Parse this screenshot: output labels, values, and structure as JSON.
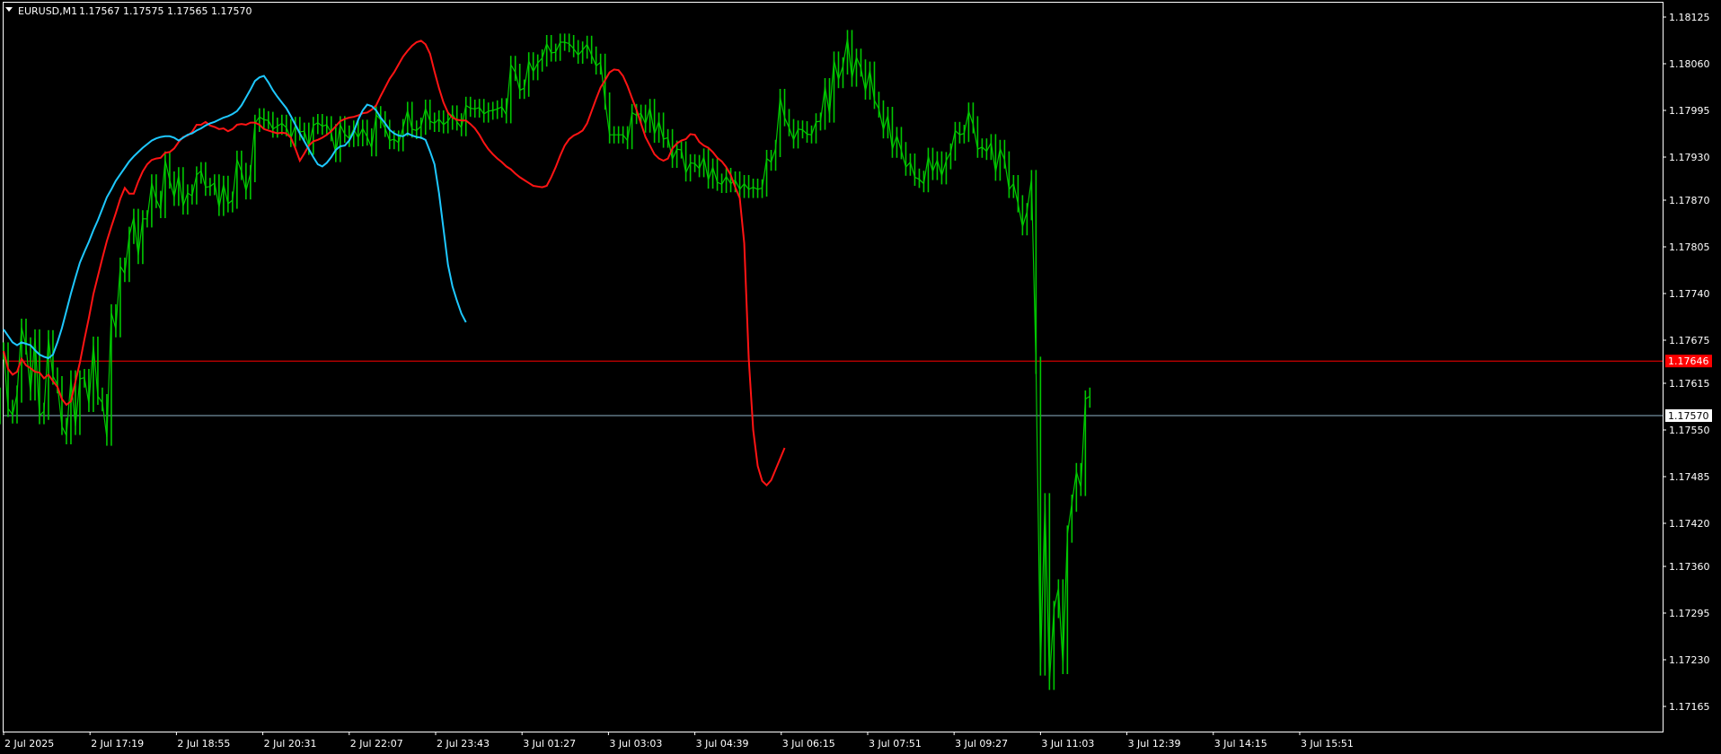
{
  "header": {
    "symbol": "EURUSD,M1",
    "ohlc": "1.17567 1.17575 1.17565 1.17570"
  },
  "colors": {
    "background": "#000000",
    "frame": "#ffffff",
    "candles": "#00c800",
    "ma_fast": "#ff1414",
    "ma_slow": "#1ec8ff",
    "bid_line": "#ff0000",
    "last_line": "#8fb4c8"
  },
  "chart_data": {
    "type": "line",
    "title": "EURUSD,M1",
    "grid": false,
    "ylim": [
      1.1713,
      1.18145
    ],
    "y_ticks": [
      "1.18125",
      "1.18060",
      "1.17995",
      "1.17930",
      "1.17870",
      "1.17805",
      "1.17740",
      "1.17675",
      "1.17615",
      "1.17550",
      "1.17485",
      "1.17420",
      "1.17360",
      "1.17295",
      "1.17230",
      "1.17165"
    ],
    "x_ticks": [
      "2 Jul 2025",
      "2 Jul 17:19",
      "2 Jul 18:55",
      "2 Jul 20:31",
      "2 Jul 22:07",
      "2 Jul 23:43",
      "3 Jul 01:27",
      "3 Jul 03:03",
      "3 Jul 04:39",
      "3 Jul 06:15",
      "3 Jul 07:51",
      "3 Jul 09:27",
      "3 Jul 11:03",
      "3 Jul 12:39",
      "3 Jul 14:15",
      "3 Jul 15:51"
    ],
    "price_labels": [
      {
        "value": 1.17646,
        "text": "1.17646",
        "style": "bid"
      },
      {
        "value": 1.1757,
        "text": "1.17570",
        "style": "last"
      }
    ],
    "x": [
      0,
      5,
      10,
      15,
      20,
      25,
      30,
      35,
      40,
      45,
      50,
      55,
      60,
      65,
      70,
      75,
      80,
      85,
      90,
      95,
      100,
      105,
      110,
      115,
      120,
      125,
      130,
      135,
      140,
      145,
      150,
      155,
      160,
      165,
      170,
      175,
      180,
      185,
      190,
      195,
      200,
      205,
      210,
      215,
      220,
      225,
      230,
      235,
      240,
      245,
      250,
      255,
      260,
      265,
      270,
      275,
      280,
      285,
      290,
      295,
      300,
      305,
      310,
      315,
      320,
      325,
      330,
      335,
      340,
      345,
      350,
      355,
      360,
      365,
      370,
      375,
      380,
      385,
      390,
      395,
      400,
      405,
      410,
      415,
      420,
      425,
      430,
      435,
      440,
      445,
      450,
      455,
      460,
      465,
      470,
      475,
      480,
      485,
      490,
      495,
      500,
      505,
      510,
      515,
      520,
      525,
      530,
      535,
      540,
      545,
      550,
      555,
      560,
      565,
      570,
      575,
      580,
      585,
      590,
      595,
      600,
      605,
      610,
      615,
      620,
      625,
      630,
      635,
      640,
      645,
      650,
      655,
      660,
      665,
      670,
      675,
      680,
      685,
      690,
      695,
      700,
      705,
      710,
      715,
      720,
      725,
      730,
      735,
      740,
      745,
      750,
      755,
      760,
      765,
      770,
      775,
      780,
      785,
      790,
      795,
      800,
      805,
      810,
      815,
      820,
      825,
      830,
      835,
      840,
      845,
      850,
      855,
      860,
      865,
      870,
      875,
      880,
      885,
      890,
      895,
      900,
      905,
      910,
      915,
      920,
      925,
      930,
      935,
      940,
      945,
      950,
      955,
      960,
      965,
      970,
      975,
      980,
      985,
      990,
      995,
      1000,
      1005,
      1010,
      1015,
      1020,
      1025,
      1030,
      1035,
      1040,
      1045,
      1050,
      1055,
      1060,
      1065,
      1070,
      1075,
      1080,
      1085,
      1090,
      1095,
      1100,
      1105,
      1110,
      1115,
      1120,
      1125,
      1130,
      1135,
      1140,
      1145,
      1150,
      1155,
      1160,
      1165,
      1170,
      1175,
      1180,
      1185,
      1190,
      1195,
      1200,
      1205,
      1210
    ],
    "series": [
      {
        "role": "price",
        "values": [
          1.1766,
          1.1758,
          1.17571,
          1.176,
          1.17693,
          1.17667,
          1.17603,
          1.17678,
          1.1757,
          1.17576,
          1.17677,
          1.17625,
          1.17613,
          1.17555,
          1.17542,
          1.17621,
          1.17555,
          1.17621,
          1.17623,
          1.17587,
          1.17668,
          1.17597,
          1.17588,
          1.1754,
          1.17713,
          1.17691,
          1.17778,
          1.17768,
          1.17821,
          1.17846,
          1.17793,
          1.17844,
          1.17844,
          1.17894,
          1.17871,
          1.17857,
          1.17926,
          1.17898,
          1.17874,
          1.17904,
          1.17862,
          1.1788,
          1.17876,
          1.17905,
          1.17911,
          1.17888,
          1.17889,
          1.17894,
          1.1786,
          1.17892,
          1.17865,
          1.1787,
          1.17927,
          1.1791,
          1.17883,
          1.17907,
          1.17977,
          1.17986,
          1.17982,
          1.17981,
          1.17969,
          1.17973,
          1.17977,
          1.17971,
          1.17956,
          1.17974,
          1.17965,
          1.17966,
          1.17945,
          1.17974,
          1.17978,
          1.17973,
          1.17975,
          1.17964,
          1.17935,
          1.17975,
          1.17962,
          1.17956,
          1.17969,
          1.17957,
          1.1797,
          1.17958,
          1.17943,
          1.17989,
          1.17982,
          1.1797,
          1.17953,
          1.17955,
          1.1795,
          1.17971,
          1.17995,
          1.17969,
          1.17967,
          1.17973,
          1.17998,
          1.1798,
          1.17977,
          1.17983,
          1.17975,
          1.1798,
          1.1799,
          1.17979,
          1.17971,
          1.18002,
          1.17998,
          1.17997,
          1.17999,
          1.1799,
          1.17994,
          1.17995,
          1.17997,
          1.18,
          1.17989,
          1.18059,
          1.18048,
          1.18023,
          1.18026,
          1.18064,
          1.18049,
          1.18061,
          1.18068,
          1.18088,
          1.18075,
          1.18076,
          1.1809,
          1.1809,
          1.18088,
          1.18081,
          1.18072,
          1.18079,
          1.18087,
          1.18072,
          1.18057,
          1.18062,
          1.18008,
          1.17961,
          1.17961,
          1.17961,
          1.17961,
          1.17953,
          1.17992,
          1.17988,
          1.17991,
          1.17976,
          1.17999,
          1.17962,
          1.1798,
          1.17955,
          1.17957,
          1.17927,
          1.17941,
          1.1794,
          1.17908,
          1.17922,
          1.17921,
          1.17914,
          1.1793,
          1.17898,
          1.17916,
          1.17895,
          1.17892,
          1.17903,
          1.17893,
          1.17898,
          1.17885,
          1.17893,
          1.17885,
          1.17888,
          1.17885,
          1.17887,
          1.17928,
          1.17923,
          1.17942,
          1.18013,
          1.17985,
          1.17971,
          1.17954,
          1.17969,
          1.17968,
          1.17962,
          1.17961,
          1.17979,
          1.1798,
          1.18028,
          1.1799,
          1.18065,
          1.18038,
          1.18057,
          1.18095,
          1.1804,
          1.18069,
          1.18054,
          1.18022,
          1.18051,
          1.18009,
          1.17997,
          1.17968,
          1.17988,
          1.17941,
          1.1796,
          1.17939,
          1.17916,
          1.17923,
          1.17902,
          1.17899,
          1.17893,
          1.17931,
          1.1791,
          1.17926,
          1.17904,
          1.17925,
          1.17937,
          1.17967,
          1.17961,
          1.17963,
          1.17994,
          1.17975,
          1.17941,
          1.17944,
          1.17938,
          1.1795,
          1.17909,
          1.17942,
          1.17926,
          1.17885,
          1.17893,
          1.17865,
          1.17833,
          1.17854,
          1.179,
          1.1764,
          1.1722,
          1.1745,
          1.172,
          1.173,
          1.1733,
          1.17222,
          1.17405,
          1.17448,
          1.17492,
          1.1747,
          1.17593,
          1.17597,
          1.1757
        ]
      },
      {
        "role": "ma_fast",
        "values": [
          1.1766,
          1.17635,
          1.17627,
          1.17631,
          1.17649,
          1.1764,
          1.17636,
          1.17631,
          1.1763,
          1.17622,
          1.17627,
          1.17618,
          1.1761,
          1.17593,
          1.17585,
          1.1759,
          1.17617,
          1.17644,
          1.17676,
          1.17706,
          1.17739,
          1.17764,
          1.17789,
          1.17813,
          1.17833,
          1.17852,
          1.17872,
          1.17887,
          1.17879,
          1.17879,
          1.17896,
          1.1791,
          1.1792,
          1.17926,
          1.17928,
          1.17929,
          1.17936,
          1.17937,
          1.17942,
          1.17951,
          1.17958,
          1.1796,
          1.17965,
          1.17975,
          1.17975,
          1.17979,
          1.17974,
          1.17972,
          1.17969,
          1.1797,
          1.17966,
          1.17969,
          1.17975,
          1.17976,
          1.17975,
          1.17978,
          1.17978,
          1.17975,
          1.17969,
          1.17967,
          1.17965,
          1.17963,
          1.17964,
          1.17963,
          1.17957,
          1.17942,
          1.17925,
          1.17935,
          1.17946,
          1.17952,
          1.17954,
          1.17957,
          1.17961,
          1.17966,
          1.17973,
          1.1798,
          1.17983,
          1.17985,
          1.17986,
          1.17988,
          1.17991,
          1.17992,
          1.17996,
          1.18002,
          1.18015,
          1.18027,
          1.18039,
          1.18048,
          1.18059,
          1.1807,
          1.18078,
          1.18085,
          1.1809,
          1.18092,
          1.18087,
          1.18074,
          1.18049,
          1.18026,
          1.18006,
          1.17992,
          1.17985,
          1.17982,
          1.17981,
          1.17981,
          1.17976,
          1.1797,
          1.17961,
          1.1795,
          1.17941,
          1.17934,
          1.17928,
          1.17923,
          1.17917,
          1.17913,
          1.17907,
          1.17902,
          1.17898,
          1.17894,
          1.1789,
          1.17889,
          1.17888,
          1.1789,
          1.17902,
          1.17916,
          1.17932,
          1.17946,
          1.17955,
          1.1796,
          1.17963,
          1.17967,
          1.17977,
          1.17994,
          1.18011,
          1.18027,
          1.18037,
          1.18048,
          1.18052,
          1.18051,
          1.18043,
          1.18029,
          1.18012,
          1.17996,
          1.17977,
          1.17958,
          1.17946,
          1.17934,
          1.17928,
          1.17925,
          1.17928,
          1.17942,
          1.17949,
          1.17953,
          1.17955,
          1.17962,
          1.17961,
          1.17951,
          1.17946,
          1.17943,
          1.17937,
          1.17929,
          1.17924,
          1.17916,
          1.17905,
          1.17888,
          1.17873,
          1.1781,
          1.1765,
          1.1755,
          1.175,
          1.17479,
          1.17473,
          1.1748,
          1.17495,
          1.1751,
          1.17525
        ]
      },
      {
        "role": "ma_slow",
        "values": [
          1.1769,
          1.17681,
          1.17672,
          1.17668,
          1.17672,
          1.1767,
          1.17668,
          1.17661,
          1.17655,
          1.17652,
          1.1765,
          1.17655,
          1.17672,
          1.17692,
          1.17716,
          1.1774,
          1.17762,
          1.17783,
          1.17798,
          1.17812,
          1.17828,
          1.17842,
          1.17858,
          1.17874,
          1.17885,
          1.17897,
          1.17906,
          1.17915,
          1.17924,
          1.17931,
          1.17937,
          1.17943,
          1.17948,
          1.17953,
          1.17956,
          1.17958,
          1.17959,
          1.17959,
          1.17957,
          1.17953,
          1.17957,
          1.17961,
          1.17963,
          1.17967,
          1.1797,
          1.17974,
          1.17977,
          1.17979,
          1.17982,
          1.17985,
          1.17987,
          1.1799,
          1.17994,
          1.18002,
          1.18013,
          1.18024,
          1.18036,
          1.18041,
          1.18043,
          1.18034,
          1.18023,
          1.18014,
          1.18006,
          1.17998,
          1.17987,
          1.17975,
          1.17963,
          1.17952,
          1.17941,
          1.1793,
          1.1792,
          1.17917,
          1.17922,
          1.1793,
          1.1794,
          1.17945,
          1.17946,
          1.17953,
          1.17965,
          1.17982,
          1.17995,
          1.18003,
          1.18001,
          1.17995,
          1.17985,
          1.17977,
          1.17968,
          1.17963,
          1.1796,
          1.17959,
          1.17963,
          1.1796,
          1.17958,
          1.17957,
          1.17954,
          1.17938,
          1.1792,
          1.1788,
          1.1783,
          1.1778,
          1.1775,
          1.1773,
          1.17712,
          1.177
        ]
      }
    ]
  }
}
